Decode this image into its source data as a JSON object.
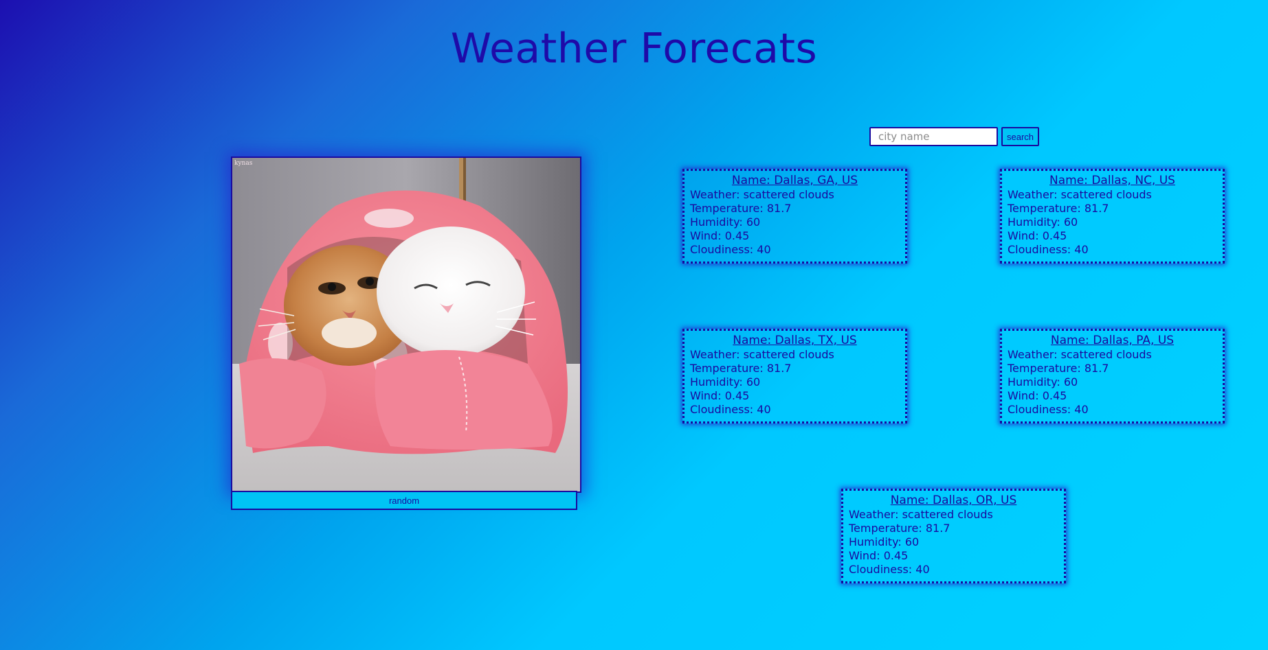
{
  "page": {
    "title": "Weather Forecats"
  },
  "search": {
    "placeholder": "city name",
    "value": "",
    "button_label": "search"
  },
  "cat_panel": {
    "watermark": "kynas",
    "random_label": "random"
  },
  "labels": {
    "name": "Name: ",
    "weather": "Weather: ",
    "temperature": "Temperature: ",
    "humidity": "Humidity: ",
    "wind": "Wind: ",
    "cloudiness": "Cloudiness: "
  },
  "cards": [
    {
      "name": "Dallas, GA, US",
      "weather": "scattered clouds",
      "temperature": "81.7",
      "humidity": "60",
      "wind": "0.45",
      "cloudiness": "40"
    },
    {
      "name": "Dallas, NC, US",
      "weather": "scattered clouds",
      "temperature": "81.7",
      "humidity": "60",
      "wind": "0.45",
      "cloudiness": "40"
    },
    {
      "name": "Dallas, TX, US",
      "weather": "scattered clouds",
      "temperature": "81.7",
      "humidity": "60",
      "wind": "0.45",
      "cloudiness": "40"
    },
    {
      "name": "Dallas, PA, US",
      "weather": "scattered clouds",
      "temperature": "81.7",
      "humidity": "60",
      "wind": "0.45",
      "cloudiness": "40"
    },
    {
      "name": "Dallas, OR, US",
      "weather": "scattered clouds",
      "temperature": "81.7",
      "humidity": "60",
      "wind": "0.45",
      "cloudiness": "40"
    }
  ],
  "colors": {
    "text": "#1a0a9e",
    "button_bg": "#00c4f5",
    "gradient_start": "#1c0fb0",
    "gradient_end": "#00d2ff",
    "blanket": "#f27a8c"
  }
}
